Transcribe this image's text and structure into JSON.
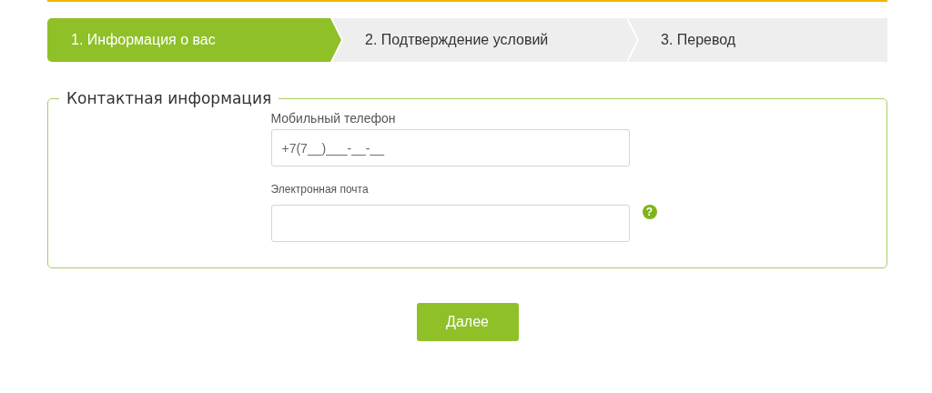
{
  "steps": [
    {
      "label": "1. Информация о вас",
      "selected": true
    },
    {
      "label": "2. Подтверждение условий",
      "selected": false
    },
    {
      "label": "3. Перевод",
      "selected": false
    }
  ],
  "section": {
    "title": "Контактная информация",
    "fields": [
      {
        "label": "Мобильный телефон",
        "placeholder": "+7(7__)___-__-__"
      },
      {
        "label": "Электронная почта",
        "help_text": "?"
      }
    ]
  },
  "next_button": "Далее"
}
